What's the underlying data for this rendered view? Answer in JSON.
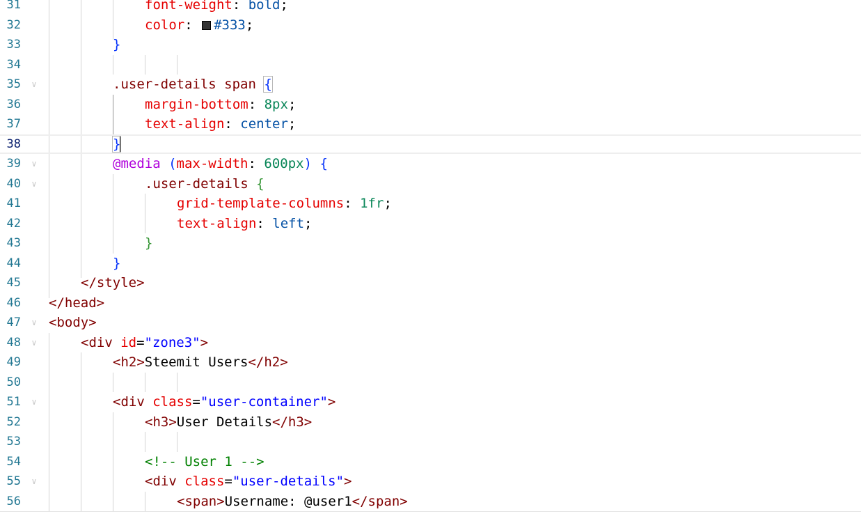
{
  "editor": {
    "language": "html",
    "current_line": "38",
    "colors": {
      "line_number": "#237893",
      "tag": "#800000",
      "attribute": "#e50000",
      "string": "#0000ff",
      "css_property": "#e50000",
      "css_number": "#098658",
      "css_keyword": "#0451a5",
      "at_rule": "#af00db",
      "comment": "#008000",
      "bracket_level1": "#0431fa",
      "bracket_level2": "#319331"
    },
    "swatch_color": "#333333",
    "lines": [
      {
        "num": "31",
        "tokens": [
          {
            "t": "font-weight",
            "c": "t-prop"
          },
          {
            "t": ": ",
            "c": "t-punc"
          },
          {
            "t": "bold",
            "c": "t-kw"
          },
          {
            "t": ";",
            "c": "t-punc"
          }
        ]
      },
      {
        "num": "32",
        "tokens": [
          {
            "t": "color",
            "c": "t-prop"
          },
          {
            "t": ": ",
            "c": "t-punc"
          },
          {
            "t": "#333",
            "c": "t-kw"
          },
          {
            "t": ";",
            "c": "t-punc"
          }
        ]
      },
      {
        "num": "33",
        "tokens": [
          {
            "t": "}",
            "c": "t-b1"
          }
        ]
      },
      {
        "num": "34",
        "tokens": []
      },
      {
        "num": "35",
        "tokens": [
          {
            "t": ".user-details span ",
            "c": "t-sel"
          },
          {
            "t": "{",
            "c": "t-b1"
          }
        ]
      },
      {
        "num": "36",
        "tokens": [
          {
            "t": "margin-bottom",
            "c": "t-prop"
          },
          {
            "t": ": ",
            "c": "t-punc"
          },
          {
            "t": "8px",
            "c": "t-num"
          },
          {
            "t": ";",
            "c": "t-punc"
          }
        ]
      },
      {
        "num": "37",
        "tokens": [
          {
            "t": "text-align",
            "c": "t-prop"
          },
          {
            "t": ": ",
            "c": "t-punc"
          },
          {
            "t": "center",
            "c": "t-kw"
          },
          {
            "t": ";",
            "c": "t-punc"
          }
        ]
      },
      {
        "num": "38",
        "tokens": [
          {
            "t": "}",
            "c": "t-b1"
          }
        ]
      },
      {
        "num": "39",
        "tokens": [
          {
            "t": "@media",
            "c": "t-at"
          },
          {
            "t": " (",
            "c": "t-b1"
          },
          {
            "t": "max-width",
            "c": "t-prop"
          },
          {
            "t": ": ",
            "c": "t-punc"
          },
          {
            "t": "600px",
            "c": "t-num"
          },
          {
            "t": ") {",
            "c": "t-b1"
          }
        ]
      },
      {
        "num": "40",
        "tokens": [
          {
            "t": ".user-details ",
            "c": "t-sel"
          },
          {
            "t": "{",
            "c": "t-b2"
          }
        ]
      },
      {
        "num": "41",
        "tokens": [
          {
            "t": "grid-template-columns",
            "c": "t-prop"
          },
          {
            "t": ": ",
            "c": "t-punc"
          },
          {
            "t": "1fr",
            "c": "t-num"
          },
          {
            "t": ";",
            "c": "t-punc"
          }
        ]
      },
      {
        "num": "42",
        "tokens": [
          {
            "t": "text-align",
            "c": "t-prop"
          },
          {
            "t": ": ",
            "c": "t-punc"
          },
          {
            "t": "left",
            "c": "t-kw"
          },
          {
            "t": ";",
            "c": "t-punc"
          }
        ]
      },
      {
        "num": "43",
        "tokens": [
          {
            "t": "}",
            "c": "t-b2"
          }
        ]
      },
      {
        "num": "44",
        "tokens": [
          {
            "t": "}",
            "c": "t-b1"
          }
        ]
      },
      {
        "num": "45",
        "tokens": [
          {
            "t": "</",
            "c": "t-tag"
          },
          {
            "t": "style",
            "c": "t-tag"
          },
          {
            "t": ">",
            "c": "t-tag"
          }
        ]
      },
      {
        "num": "46",
        "tokens": [
          {
            "t": "</",
            "c": "t-tag"
          },
          {
            "t": "head",
            "c": "t-tag"
          },
          {
            "t": ">",
            "c": "t-tag"
          }
        ]
      },
      {
        "num": "47",
        "tokens": [
          {
            "t": "<",
            "c": "t-tag"
          },
          {
            "t": "body",
            "c": "t-tag"
          },
          {
            "t": ">",
            "c": "t-tag"
          }
        ]
      },
      {
        "num": "48",
        "tokens": [
          {
            "t": "<div ",
            "c": "t-tag"
          },
          {
            "t": "id",
            "c": "t-attr"
          },
          {
            "t": "=",
            "c": "t-punc"
          },
          {
            "t": "\"zone3\"",
            "c": "t-str"
          },
          {
            "t": ">",
            "c": "t-tag"
          }
        ]
      },
      {
        "num": "49",
        "tokens": [
          {
            "t": "<h2>",
            "c": "t-tag"
          },
          {
            "t": "Steemit Users",
            "c": "t-text"
          },
          {
            "t": "</h2>",
            "c": "t-tag"
          }
        ]
      },
      {
        "num": "50",
        "tokens": []
      },
      {
        "num": "51",
        "tokens": [
          {
            "t": "<div ",
            "c": "t-tag"
          },
          {
            "t": "class",
            "c": "t-attr"
          },
          {
            "t": "=",
            "c": "t-punc"
          },
          {
            "t": "\"user-container\"",
            "c": "t-str"
          },
          {
            "t": ">",
            "c": "t-tag"
          }
        ]
      },
      {
        "num": "52",
        "tokens": [
          {
            "t": "<h3>",
            "c": "t-tag"
          },
          {
            "t": "User Details",
            "c": "t-text"
          },
          {
            "t": "</h3>",
            "c": "t-tag"
          }
        ]
      },
      {
        "num": "53",
        "tokens": []
      },
      {
        "num": "54",
        "tokens": [
          {
            "t": "<!-- User 1 -->",
            "c": "t-cmt"
          }
        ]
      },
      {
        "num": "55",
        "tokens": [
          {
            "t": "<div ",
            "c": "t-tag"
          },
          {
            "t": "class",
            "c": "t-attr"
          },
          {
            "t": "=",
            "c": "t-punc"
          },
          {
            "t": "\"user-details\"",
            "c": "t-str"
          },
          {
            "t": ">",
            "c": "t-tag"
          }
        ]
      },
      {
        "num": "56",
        "tokens": [
          {
            "t": "<span>",
            "c": "t-tag"
          },
          {
            "t": "Username: @user1",
            "c": "t-text"
          },
          {
            "t": "</span>",
            "c": "t-tag"
          }
        ]
      }
    ]
  }
}
